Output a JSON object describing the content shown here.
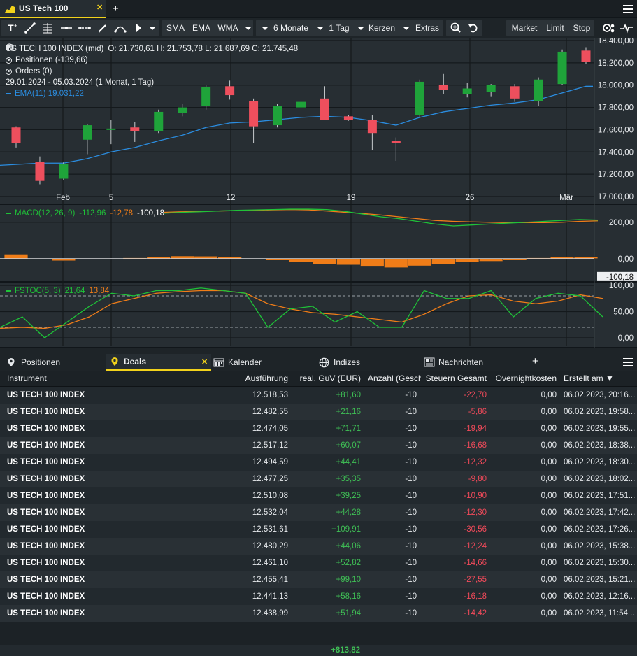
{
  "window": {
    "tab_title": "US Tech 100"
  },
  "toolbar": {
    "indicators": [
      "SMA",
      "EMA",
      "WMA"
    ],
    "period": "6 Monate",
    "interval": "1 Tag",
    "chart_style": "Kerzen",
    "extras": "Extras",
    "order_buttons": [
      "Market",
      "Limit",
      "Stop"
    ]
  },
  "legend": {
    "instrument": "US TECH 100 INDEX (mid)",
    "ohlc": "O: 21.730,61  H: 21.753,78  L: 21.687,69  C: 21.745,48",
    "positions": "Positionen (-139,66)",
    "orders": "Orders (0)",
    "range": "29.01.2024 - 05.03.2024  (1 Monat, 1 Tag)",
    "ema": "EMA(11)  19.031,22",
    "macd_label": "MACD(12, 26, 9)",
    "macd_v1": "-112,96",
    "macd_v2": "-12,78",
    "macd_v3": "-100,18",
    "stoch_label": "FSTOC(5, 3)",
    "stoch_v1": "21,64",
    "stoch_v2": "13,84"
  },
  "colors": {
    "up": "#1fa33a",
    "down": "#ee4f5d",
    "ema": "#2b8de0",
    "macd": "#1fc238",
    "signal": "#f07d18",
    "accent": "#f2d21b"
  },
  "chart_data": [
    {
      "type": "candlestick",
      "x_labels": [
        "Feb",
        "5",
        "12",
        "19",
        "26",
        "Mär"
      ],
      "y_ticks": [
        "18.400,00",
        "18.200,00",
        "18.000,00",
        "17.800,00",
        "17.600,00",
        "17.400,00",
        "17.200,00",
        "17.000,00"
      ],
      "ylim": [
        17000,
        18400
      ],
      "candles": [
        {
          "o": 17620,
          "h": 17630,
          "l": 17440,
          "c": 17480
        },
        {
          "o": 17310,
          "h": 17360,
          "l": 17110,
          "c": 17140
        },
        {
          "o": 17160,
          "h": 17310,
          "l": 17150,
          "c": 17290
        },
        {
          "o": 17510,
          "h": 17650,
          "l": 17380,
          "c": 17640
        },
        {
          "o": 17600,
          "h": 17690,
          "l": 17470,
          "c": 17610
        },
        {
          "o": 17620,
          "h": 17670,
          "l": 17490,
          "c": 17590
        },
        {
          "o": 17590,
          "h": 17780,
          "l": 17570,
          "c": 17760
        },
        {
          "o": 17750,
          "h": 17830,
          "l": 17720,
          "c": 17800
        },
        {
          "o": 17810,
          "h": 18000,
          "l": 17780,
          "c": 17980
        },
        {
          "o": 17990,
          "h": 18040,
          "l": 17870,
          "c": 17910
        },
        {
          "o": 17860,
          "h": 17880,
          "l": 17480,
          "c": 17630
        },
        {
          "o": 17640,
          "h": 17830,
          "l": 17620,
          "c": 17810
        },
        {
          "o": 17800,
          "h": 17870,
          "l": 17740,
          "c": 17850
        },
        {
          "o": 17880,
          "h": 17990,
          "l": 17690,
          "c": 17690
        },
        {
          "o": 17720,
          "h": 17730,
          "l": 17680,
          "c": 17690
        },
        {
          "o": 17690,
          "h": 17730,
          "l": 17420,
          "c": 17570
        },
        {
          "o": 17500,
          "h": 17530,
          "l": 17320,
          "c": 17480
        },
        {
          "o": 17730,
          "h": 18050,
          "l": 17710,
          "c": 18030
        },
        {
          "o": 18000,
          "h": 18100,
          "l": 17920,
          "c": 17960
        },
        {
          "o": 17920,
          "h": 18020,
          "l": 17890,
          "c": 17970
        },
        {
          "o": 17940,
          "h": 18010,
          "l": 17900,
          "c": 18000
        },
        {
          "o": 17990,
          "h": 18010,
          "l": 17850,
          "c": 17880
        },
        {
          "o": 17860,
          "h": 18070,
          "l": 17810,
          "c": 18050
        },
        {
          "o": 18010,
          "h": 18320,
          "l": 18000,
          "c": 18300
        },
        {
          "o": 18310,
          "h": 18340,
          "l": 18190,
          "c": 18210
        }
      ],
      "ema": [
        17280,
        17300,
        17300,
        17340,
        17400,
        17440,
        17500,
        17550,
        17620,
        17660,
        17670,
        17690,
        17710,
        17720,
        17710,
        17680,
        17640,
        17710,
        17760,
        17790,
        17820,
        17840,
        17870,
        17930,
        17990
      ]
    },
    {
      "type": "bar+line",
      "name": "MACD(12, 26, 9)",
      "y_ticks": [
        "200,00",
        "0,00",
        "-100,18"
      ],
      "ylim": [
        -120,
        280
      ],
      "macd": [
        250,
        255,
        258,
        262,
        266,
        268,
        270,
        272,
        272,
        270,
        260,
        245,
        230,
        220,
        205,
        190,
        180,
        185,
        190,
        195,
        200,
        205,
        210,
        215,
        212
      ],
      "signal": [
        255,
        258,
        260,
        262,
        264,
        266,
        268,
        270,
        268,
        262,
        255,
        248,
        240,
        230,
        220,
        210,
        205,
        202,
        200,
        198,
        198,
        198,
        200,
        205,
        208
      ],
      "histogram": [
        25,
        0,
        -12,
        -5,
        0,
        5,
        10,
        15,
        14,
        10,
        0,
        -10,
        -20,
        -30,
        -35,
        -45,
        -50,
        -40,
        -30,
        -20,
        -15,
        -10,
        5,
        10,
        12
      ]
    },
    {
      "type": "line",
      "name": "FSTOC(5, 3)",
      "y_ticks": [
        "100,00",
        "50,00",
        "0,00"
      ],
      "ylim": [
        0,
        100
      ],
      "k": [
        20,
        40,
        0,
        30,
        60,
        85,
        80,
        90,
        90,
        95,
        90,
        85,
        20,
        55,
        60,
        30,
        50,
        20,
        20,
        90,
        75,
        75,
        90,
        40,
        75,
        85,
        80,
        40
      ],
      "d": [
        18,
        20,
        18,
        25,
        40,
        65,
        75,
        85,
        88,
        90,
        90,
        85,
        65,
        55,
        48,
        45,
        40,
        35,
        30,
        45,
        65,
        80,
        82,
        70,
        65,
        70,
        82,
        75
      ]
    }
  ],
  "panel": {
    "tabs": [
      "Positionen",
      "Deals",
      "Kalender",
      "Indizes",
      "Nachrichten"
    ],
    "columns": [
      "Instrument",
      "Ausführung",
      "real. GuV (EUR)",
      "Anzahl (Geschl",
      "Steuern Gesamt",
      "Overnightkosten",
      "Erstellt am ▼"
    ],
    "rows": [
      {
        "instrument": "US TECH 100 INDEX",
        "ausfuehrung": "12.518,53",
        "guv": "+81,60",
        "anzahl": "-10",
        "steuern": "-22,70",
        "overnight": "0,00",
        "erstellt": "06.02.2023, 20:16..."
      },
      {
        "instrument": "US TECH 100 INDEX",
        "ausfuehrung": "12.482,55",
        "guv": "+21,16",
        "anzahl": "-10",
        "steuern": "-5,86",
        "overnight": "0,00",
        "erstellt": "06.02.2023, 19:58..."
      },
      {
        "instrument": "US TECH 100 INDEX",
        "ausfuehrung": "12.474,05",
        "guv": "+71,71",
        "anzahl": "-10",
        "steuern": "-19,94",
        "overnight": "0,00",
        "erstellt": "06.02.2023, 19:55..."
      },
      {
        "instrument": "US TECH 100 INDEX",
        "ausfuehrung": "12.517,12",
        "guv": "+60,07",
        "anzahl": "-10",
        "steuern": "-16,68",
        "overnight": "0,00",
        "erstellt": "06.02.2023, 18:38..."
      },
      {
        "instrument": "US TECH 100 INDEX",
        "ausfuehrung": "12.494,59",
        "guv": "+44,41",
        "anzahl": "-10",
        "steuern": "-12,32",
        "overnight": "0,00",
        "erstellt": "06.02.2023, 18:30..."
      },
      {
        "instrument": "US TECH 100 INDEX",
        "ausfuehrung": "12.477,25",
        "guv": "+35,35",
        "anzahl": "-10",
        "steuern": "-9,80",
        "overnight": "0,00",
        "erstellt": "06.02.2023, 18:02..."
      },
      {
        "instrument": "US TECH 100 INDEX",
        "ausfuehrung": "12.510,08",
        "guv": "+39,25",
        "anzahl": "-10",
        "steuern": "-10,90",
        "overnight": "0,00",
        "erstellt": "06.02.2023, 17:51..."
      },
      {
        "instrument": "US TECH 100 INDEX",
        "ausfuehrung": "12.532,04",
        "guv": "+44,28",
        "anzahl": "-10",
        "steuern": "-12,30",
        "overnight": "0,00",
        "erstellt": "06.02.2023, 17:42..."
      },
      {
        "instrument": "US TECH 100 INDEX",
        "ausfuehrung": "12.531,61",
        "guv": "+109,91",
        "anzahl": "-10",
        "steuern": "-30,56",
        "overnight": "0,00",
        "erstellt": "06.02.2023, 17:26..."
      },
      {
        "instrument": "US TECH 100 INDEX",
        "ausfuehrung": "12.480,29",
        "guv": "+44,06",
        "anzahl": "-10",
        "steuern": "-12,24",
        "overnight": "0,00",
        "erstellt": "06.02.2023, 15:38..."
      },
      {
        "instrument": "US TECH 100 INDEX",
        "ausfuehrung": "12.461,10",
        "guv": "+52,82",
        "anzahl": "-10",
        "steuern": "-14,66",
        "overnight": "0,00",
        "erstellt": "06.02.2023, 15:30..."
      },
      {
        "instrument": "US TECH 100 INDEX",
        "ausfuehrung": "12.455,41",
        "guv": "+99,10",
        "anzahl": "-10",
        "steuern": "-27,55",
        "overnight": "0,00",
        "erstellt": "06.02.2023, 15:21..."
      },
      {
        "instrument": "US TECH 100 INDEX",
        "ausfuehrung": "12.441,13",
        "guv": "+58,16",
        "anzahl": "-10",
        "steuern": "-16,18",
        "overnight": "0,00",
        "erstellt": "06.02.2023, 12:16..."
      },
      {
        "instrument": "US TECH 100 INDEX",
        "ausfuehrung": "12.438,99",
        "guv": "+51,94",
        "anzahl": "-10",
        "steuern": "-14,42",
        "overnight": "0,00",
        "erstellt": "06.02.2023, 11:54..."
      }
    ],
    "total_guv": "+813,82"
  }
}
